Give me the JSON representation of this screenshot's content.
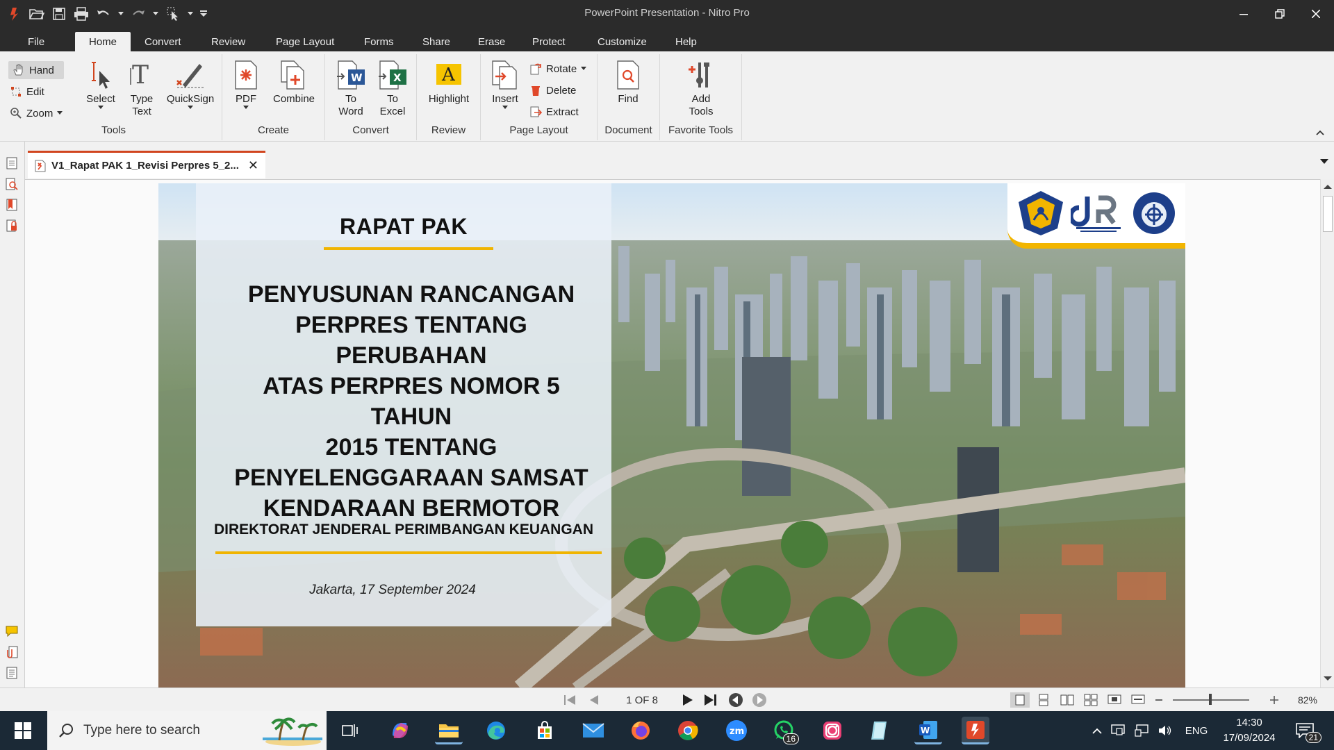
{
  "window": {
    "title": "PowerPoint Presentation - Nitro Pro"
  },
  "menu": {
    "tabs": [
      "File",
      "Home",
      "Convert",
      "Review",
      "Page Layout",
      "Forms",
      "Share",
      "Erase",
      "Protect",
      "Customize",
      "Help"
    ],
    "active": "Home"
  },
  "ribbon": {
    "tools": {
      "hand": "Hand",
      "edit": "Edit",
      "zoom": "Zoom",
      "select": "Select",
      "type_text_1": "Type",
      "type_text_2": "Text",
      "quicksign": "QuickSign",
      "group": "Tools"
    },
    "create": {
      "pdf": "PDF",
      "combine": "Combine",
      "group": "Create"
    },
    "convert": {
      "to_word_1": "To",
      "to_word_2": "Word",
      "to_excel_1": "To",
      "to_excel_2": "Excel",
      "group": "Convert"
    },
    "review": {
      "highlight": "Highlight",
      "group": "Review"
    },
    "page_layout": {
      "insert": "Insert",
      "rotate": "Rotate",
      "delete": "Delete",
      "extract": "Extract",
      "group": "Page Layout"
    },
    "document": {
      "find": "Find",
      "group": "Document"
    },
    "favorite": {
      "add_tools_1": "Add",
      "add_tools_2": "Tools",
      "group": "Favorite Tools"
    }
  },
  "document_tab": {
    "name": "V1_Rapat PAK 1_Revisi Perpres 5_2..."
  },
  "slide": {
    "title": "RAPAT PAK",
    "heading": [
      "PENYUSUNAN RANCANGAN",
      "PERPRES TENTANG PERUBAHAN",
      "ATAS PERPRES NOMOR 5 TAHUN",
      "2015 TENTANG",
      "PENYELENGGARAAN SAMSAT",
      "KENDARAAN BERMOTOR"
    ],
    "directorate": "DIREKTORAT JENDERAL PERIMBANGAN KEUANGAN",
    "date": "Jakarta, 17 September 2024"
  },
  "navigation": {
    "page_indicator": "1 OF 8",
    "zoom": "82%"
  },
  "taskbar": {
    "search_placeholder": "Type here to search",
    "language": "ENG",
    "time": "14:30",
    "date": "17/09/2024",
    "whatsapp_badge": "16",
    "notifications": "21"
  },
  "colors": {
    "accent": "#d1451e",
    "slide_underline": "#f0b400",
    "titlebar": "#2b2b2b",
    "taskbar": "#1b2936"
  }
}
